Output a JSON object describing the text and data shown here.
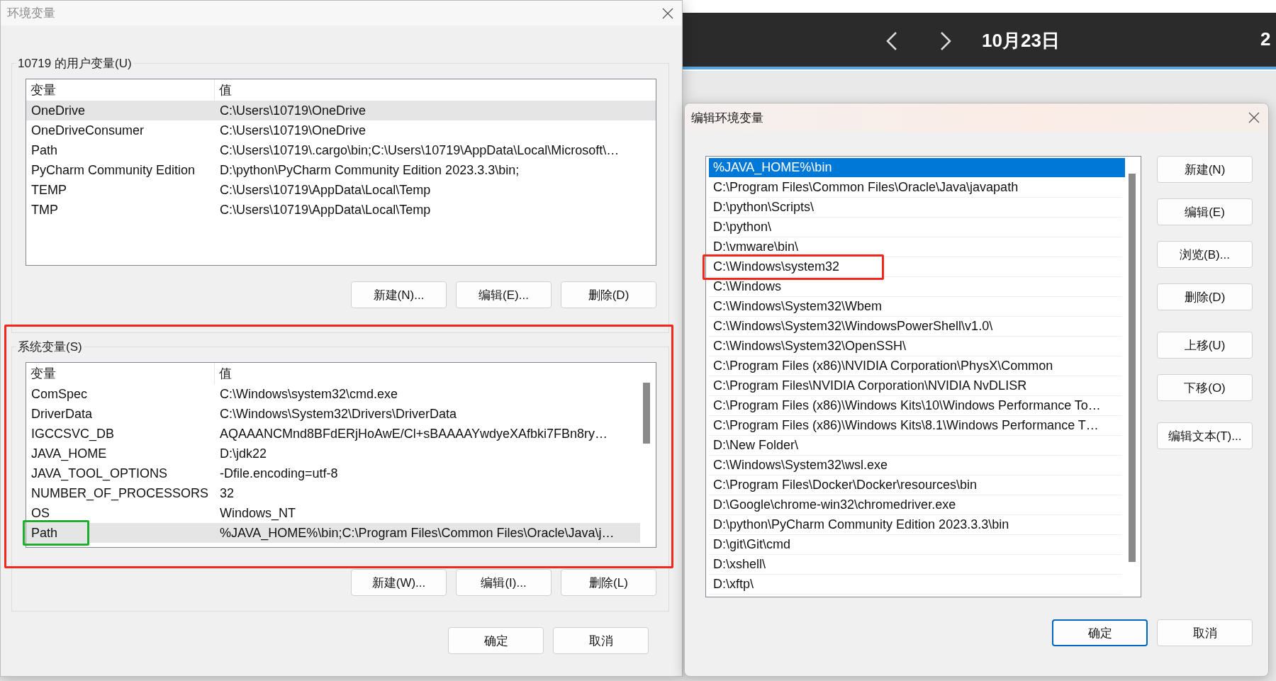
{
  "calendar_bar": {
    "date": "10月23日",
    "year_fragment": "2"
  },
  "env_dialog": {
    "title": "环境变量",
    "user_vars": {
      "label": "10719 的用户变量(U)",
      "columns": [
        "变量",
        "值"
      ],
      "rows": [
        {
          "name": "OneDrive",
          "value": "C:\\Users\\10719\\OneDrive",
          "selected": true
        },
        {
          "name": "OneDriveConsumer",
          "value": "C:\\Users\\10719\\OneDrive",
          "selected": false
        },
        {
          "name": "Path",
          "value": "C:\\Users\\10719\\.cargo\\bin;C:\\Users\\10719\\AppData\\Local\\Microsoft\\…",
          "selected": false
        },
        {
          "name": "PyCharm Community Edition",
          "value": "D:\\python\\PyCharm Community Edition 2023.3.3\\bin;",
          "selected": false
        },
        {
          "name": "TEMP",
          "value": "C:\\Users\\10719\\AppData\\Local\\Temp",
          "selected": false
        },
        {
          "name": "TMP",
          "value": "C:\\Users\\10719\\AppData\\Local\\Temp",
          "selected": false
        }
      ],
      "buttons": [
        "新建(N)...",
        "编辑(E)...",
        "删除(D)"
      ]
    },
    "system_vars": {
      "label": "系统变量(S)",
      "highlighted": true,
      "columns": [
        "变量",
        "值"
      ],
      "rows": [
        {
          "name": "ComSpec",
          "value": "C:\\Windows\\system32\\cmd.exe",
          "selected": false,
          "highlighted": false
        },
        {
          "name": "DriverData",
          "value": "C:\\Windows\\System32\\Drivers\\DriverData",
          "selected": false,
          "highlighted": false
        },
        {
          "name": "IGCCSVC_DB",
          "value": "AQAAANCMnd8BFdERjHoAwE/Cl+sBAAAAYwdyeXAfbki7FBn8ry…",
          "selected": false,
          "highlighted": false
        },
        {
          "name": "JAVA_HOME",
          "value": "D:\\jdk22",
          "selected": false,
          "highlighted": false
        },
        {
          "name": "JAVA_TOOL_OPTIONS",
          "value": "-Dfile.encoding=utf-8",
          "selected": false,
          "highlighted": false
        },
        {
          "name": "NUMBER_OF_PROCESSORS",
          "value": "32",
          "selected": false,
          "highlighted": false
        },
        {
          "name": "OS",
          "value": "Windows_NT",
          "selected": false,
          "highlighted": false
        },
        {
          "name": "Path",
          "value": "%JAVA_HOME%\\bin;C:\\Program Files\\Common Files\\Oracle\\Java\\j…",
          "selected": true,
          "highlighted": true
        }
      ],
      "buttons": [
        "新建(W)...",
        "编辑(I)...",
        "删除(L)"
      ]
    },
    "footer_buttons": [
      "确定",
      "取消"
    ]
  },
  "edit_dialog": {
    "title": "编辑环境变量",
    "entries": [
      {
        "text": "%JAVA_HOME%\\bin",
        "selected": true,
        "highlighted": false
      },
      {
        "text": "C:\\Program Files\\Common Files\\Oracle\\Java\\javapath",
        "selected": false,
        "highlighted": false
      },
      {
        "text": "D:\\python\\Scripts\\",
        "selected": false,
        "highlighted": false
      },
      {
        "text": "D:\\python\\",
        "selected": false,
        "highlighted": false
      },
      {
        "text": "D:\\vmware\\bin\\",
        "selected": false,
        "highlighted": false
      },
      {
        "text": "C:\\Windows\\system32",
        "selected": false,
        "highlighted": true
      },
      {
        "text": "C:\\Windows",
        "selected": false,
        "highlighted": false
      },
      {
        "text": "C:\\Windows\\System32\\Wbem",
        "selected": false,
        "highlighted": false
      },
      {
        "text": "C:\\Windows\\System32\\WindowsPowerShell\\v1.0\\",
        "selected": false,
        "highlighted": false
      },
      {
        "text": "C:\\Windows\\System32\\OpenSSH\\",
        "selected": false,
        "highlighted": false
      },
      {
        "text": "C:\\Program Files (x86)\\NVIDIA Corporation\\PhysX\\Common",
        "selected": false,
        "highlighted": false
      },
      {
        "text": "C:\\Program Files\\NVIDIA Corporation\\NVIDIA NvDLISR",
        "selected": false,
        "highlighted": false
      },
      {
        "text": "C:\\Program Files (x86)\\Windows Kits\\10\\Windows Performance To…",
        "selected": false,
        "highlighted": false
      },
      {
        "text": "C:\\Program Files (x86)\\Windows Kits\\8.1\\Windows Performance T…",
        "selected": false,
        "highlighted": false
      },
      {
        "text": "D:\\New Folder\\",
        "selected": false,
        "highlighted": false
      },
      {
        "text": "C:\\Windows\\System32\\wsl.exe",
        "selected": false,
        "highlighted": false
      },
      {
        "text": "C:\\Program Files\\Docker\\Docker\\resources\\bin",
        "selected": false,
        "highlighted": false
      },
      {
        "text": "D:\\Google\\chrome-win32\\chromedriver.exe",
        "selected": false,
        "highlighted": false
      },
      {
        "text": "D:\\python\\PyCharm Community Edition 2023.3.3\\bin",
        "selected": false,
        "highlighted": false
      },
      {
        "text": "D:\\git\\Git\\cmd",
        "selected": false,
        "highlighted": false
      },
      {
        "text": "D:\\xshell\\",
        "selected": false,
        "highlighted": false
      },
      {
        "text": "D:\\xftp\\",
        "selected": false,
        "highlighted": false
      }
    ],
    "button_groups": [
      [
        "新建(N)",
        "编辑(E)",
        "浏览(B)...",
        "删除(D)"
      ],
      [
        "上移(U)",
        "下移(O)"
      ],
      [
        "编辑文本(T)..."
      ]
    ],
    "footer_buttons": [
      {
        "label": "确定",
        "default": true
      },
      {
        "label": "取消",
        "default": false
      }
    ]
  }
}
